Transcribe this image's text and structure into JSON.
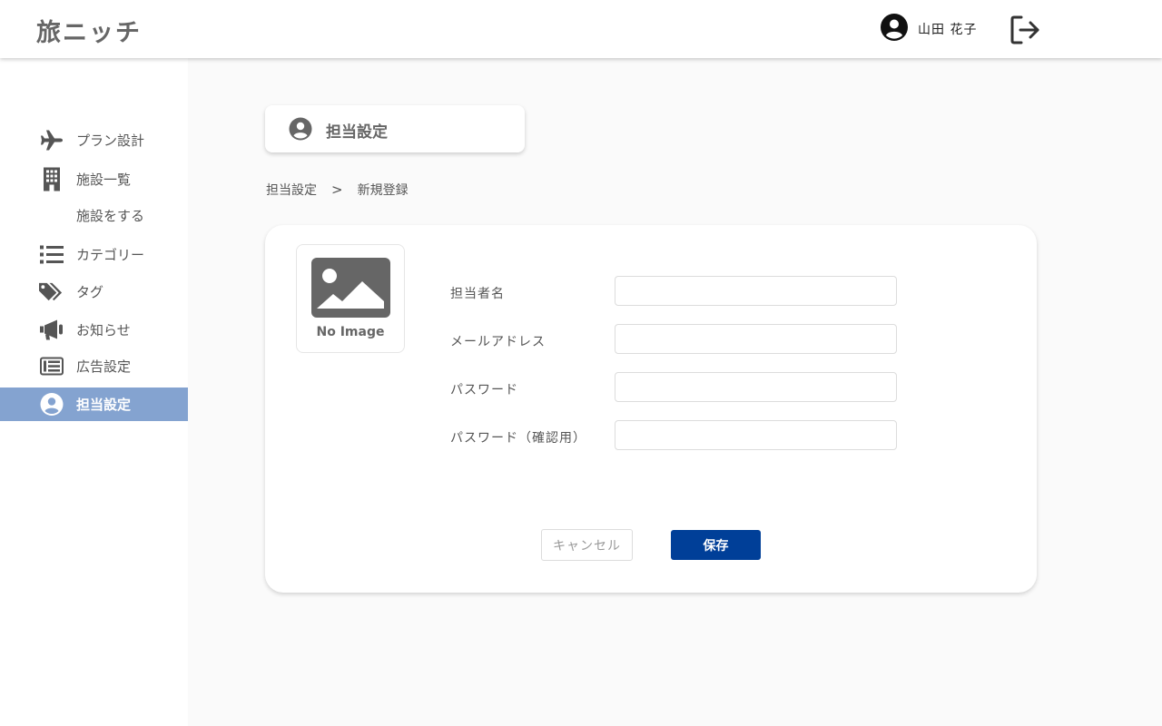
{
  "header": {
    "logo": "旅ニッチ",
    "user_name": "山田 花子",
    "user_icon": "user-circle-icon",
    "logout_icon": "logout-icon"
  },
  "sidebar": {
    "items": [
      {
        "label": "プラン設計",
        "icon": "airplane-icon"
      },
      {
        "label": "施設一覧",
        "icon": "building-icon"
      },
      {
        "label": "施設をする",
        "icon": ""
      },
      {
        "label": "カテゴリー",
        "icon": "list-icon"
      },
      {
        "label": "タグ",
        "icon": "tags-icon"
      },
      {
        "label": "お知らせ",
        "icon": "megaphone-icon"
      },
      {
        "label": "広告設定",
        "icon": "newspaper-icon"
      },
      {
        "label": "担当設定",
        "icon": "user-circle-icon",
        "active": true
      }
    ]
  },
  "page": {
    "title": "担当設定",
    "breadcrumb": {
      "parent": "担当設定",
      "separator": ">",
      "current": "新規登録"
    }
  },
  "form": {
    "image_text": "No Image",
    "fields": [
      {
        "label": "担当者名",
        "value": ""
      },
      {
        "label": "メールアドレス",
        "value": ""
      },
      {
        "label": "パスワード",
        "value": ""
      },
      {
        "label": "パスワード（確認用）",
        "value": ""
      }
    ],
    "cancel_label": "キャンセル",
    "save_label": "保存"
  },
  "colors": {
    "accent": "#003f98",
    "sidebar_active": "#84a3d0",
    "icon": "#555555"
  }
}
